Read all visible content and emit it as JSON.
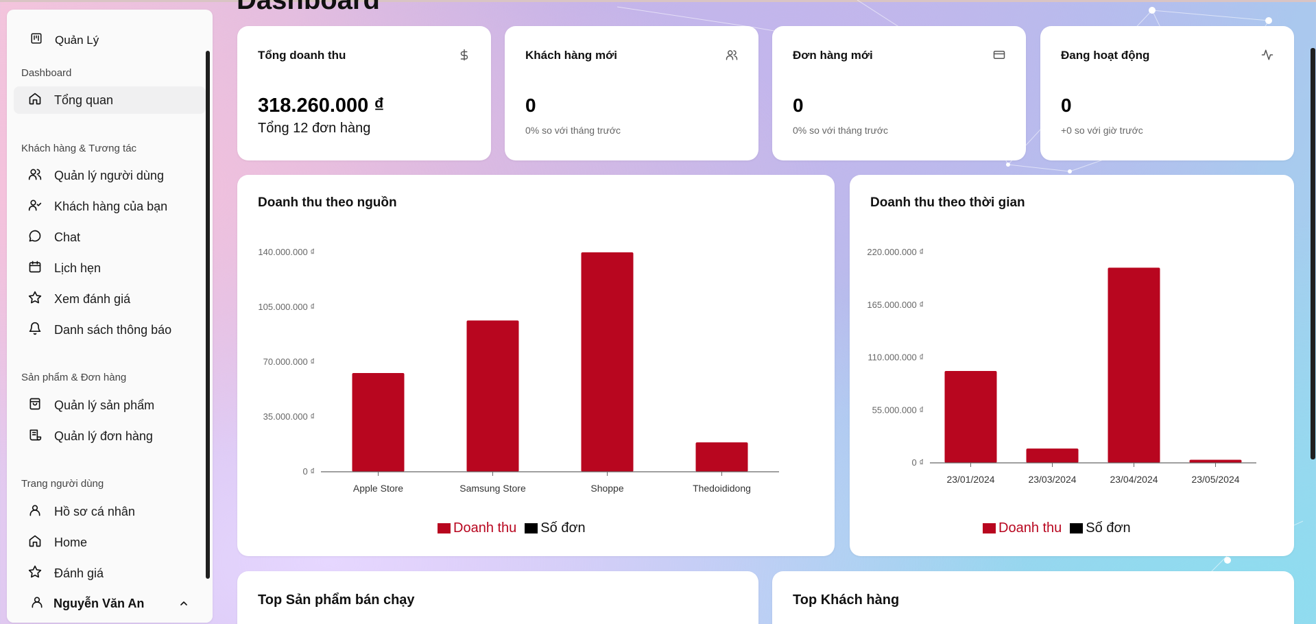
{
  "app": {
    "brand": "Quản Lý",
    "page_title": "Dashboard"
  },
  "sidebar": {
    "sections": [
      {
        "label": "Dashboard"
      },
      {
        "label": "Khách hàng & Tương tác"
      },
      {
        "label": "Sản phẩm & Đơn hàng"
      },
      {
        "label": "Trang người dùng"
      }
    ],
    "items": [
      {
        "label": "Tổng quan",
        "icon": "home-icon"
      },
      {
        "label": "Quản lý người dùng",
        "icon": "users-icon"
      },
      {
        "label": "Khách hàng của bạn",
        "icon": "user-check-icon"
      },
      {
        "label": "Chat",
        "icon": "chat-icon"
      },
      {
        "label": "Lịch hẹn",
        "icon": "calendar-icon"
      },
      {
        "label": "Xem đánh giá",
        "icon": "star-icon"
      },
      {
        "label": "Danh sách thông báo",
        "icon": "bell-icon"
      },
      {
        "label": "Quản lý sản phẩm",
        "icon": "shopping-bag-icon"
      },
      {
        "label": "Quản lý đơn hàng",
        "icon": "scroll-icon"
      },
      {
        "label": "Hồ sơ cá nhân",
        "icon": "user-icon"
      },
      {
        "label": "Home",
        "icon": "home-icon"
      },
      {
        "label": "Đánh giá",
        "icon": "star-icon"
      }
    ],
    "user_name": "Nguyễn Văn An"
  },
  "stats": [
    {
      "title": "Tổng doanh thu",
      "value": "318.260.000 ₫",
      "sub": "Tổng 12 đơn hàng",
      "icon": "dollar-icon"
    },
    {
      "title": "Khách hàng mới",
      "value": "0",
      "sub": "0% so với tháng trước",
      "icon": "users-icon"
    },
    {
      "title": "Đơn hàng mới",
      "value": "0",
      "sub": "0% so với tháng trước",
      "icon": "credit-card-icon"
    },
    {
      "title": "Đang hoạt động",
      "value": "0",
      "sub": "+0 so với giờ trước",
      "icon": "activity-icon"
    }
  ],
  "charts": {
    "source_title": "Doanh thu theo nguồn",
    "time_title": "Doanh thu theo thời gian",
    "legend": {
      "revenue": "Doanh thu",
      "orders": "Số đơn"
    }
  },
  "bottom": {
    "top_products": "Top Sản phẩm bán chạy",
    "top_customers": "Top Khách hàng"
  },
  "colors": {
    "bar": "#b8061f",
    "legend_revenue_text": "#b8061f",
    "orders": "#000000"
  },
  "chart_data": [
    {
      "type": "bar",
      "title": "Doanh thu theo nguồn",
      "categories": [
        "Apple Store",
        "Samsung Store",
        "Shoppe",
        "Thedoididong"
      ],
      "series": [
        {
          "name": "Doanh thu",
          "values": [
            63000000,
            96500000,
            140000000,
            18760000
          ]
        }
      ],
      "ylim": [
        0,
        140000000
      ],
      "yticks": [
        "0 ₫",
        "35.000.000 ₫",
        "70.000.000 ₫",
        "105.000.000 ₫",
        "140.000.000 ₫"
      ],
      "legend": [
        "Doanh thu",
        "Số đơn"
      ],
      "legend_position": "bottom"
    },
    {
      "type": "bar",
      "title": "Doanh thu theo thời gian",
      "categories": [
        "23/01/2024",
        "23/03/2024",
        "23/04/2024",
        "23/05/2024"
      ],
      "series": [
        {
          "name": "Doanh thu",
          "values": [
            96000000,
            15000000,
            204000000,
            3260000
          ]
        }
      ],
      "ylim": [
        0,
        220000000
      ],
      "yticks": [
        "0 ₫",
        "55.000.000 ₫",
        "110.000.000 ₫",
        "165.000.000 ₫",
        "220.000.000 ₫"
      ],
      "legend": [
        "Doanh thu",
        "Số đơn"
      ],
      "legend_position": "bottom"
    }
  ]
}
